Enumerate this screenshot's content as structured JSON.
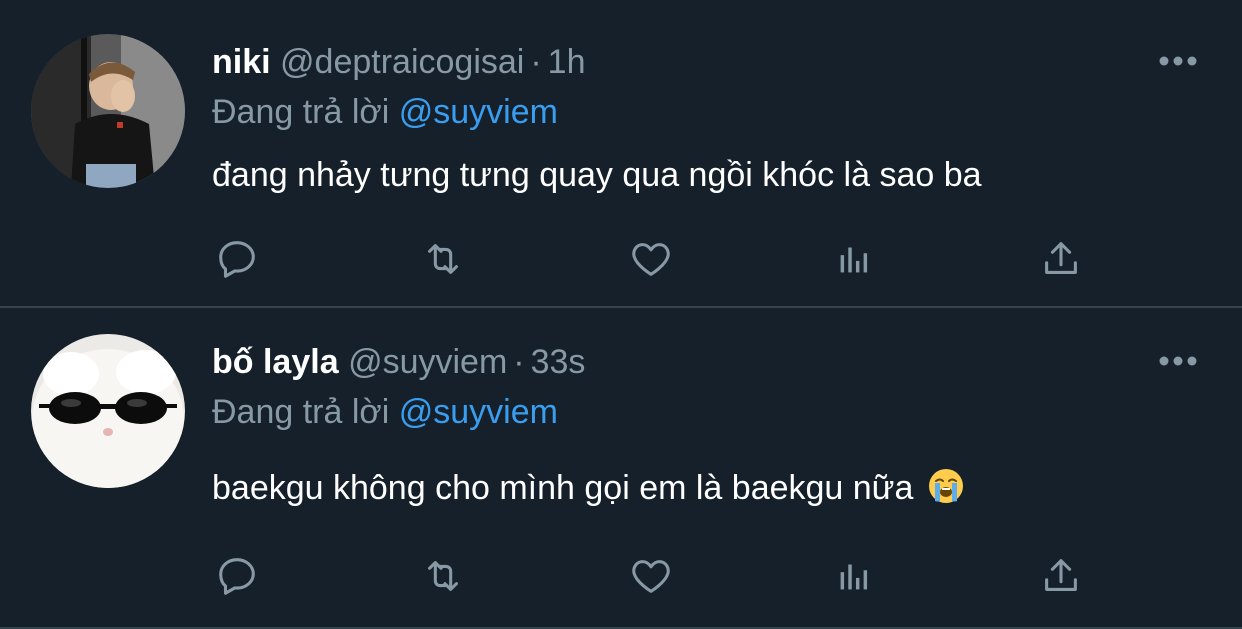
{
  "tweets": [
    {
      "name": "niki",
      "handle": "@deptraicogisai",
      "separator": "·",
      "time": "1h",
      "replying_prefix": "Đang trả lời",
      "replying_to": "@suyviem",
      "text": "đang nhảy tưng tưng quay qua ngồi khóc là sao ba",
      "avatar": "person-covering-face-avatar"
    },
    {
      "name": "bố layla",
      "handle": "@suyviem",
      "separator": "·",
      "time": "33s",
      "replying_prefix": "Đang trả lời",
      "replying_to": "@suyviem",
      "text": "baekgu không cho mình gọi em là baekgu nữa",
      "emoji": "loudly-crying-face-emoji",
      "avatar": "white-cat-sunglasses-avatar"
    }
  ],
  "icons": {
    "more": "more-horizontal-icon",
    "reply": "reply-icon",
    "retweet": "retweet-icon",
    "like": "like-heart-icon",
    "stats": "analytics-icon",
    "share": "share-icon"
  },
  "colors": {
    "background": "#15202b",
    "text": "#ffffff",
    "muted": "#8899a6",
    "link": "#3a9ef0",
    "divider": "#38444d"
  }
}
